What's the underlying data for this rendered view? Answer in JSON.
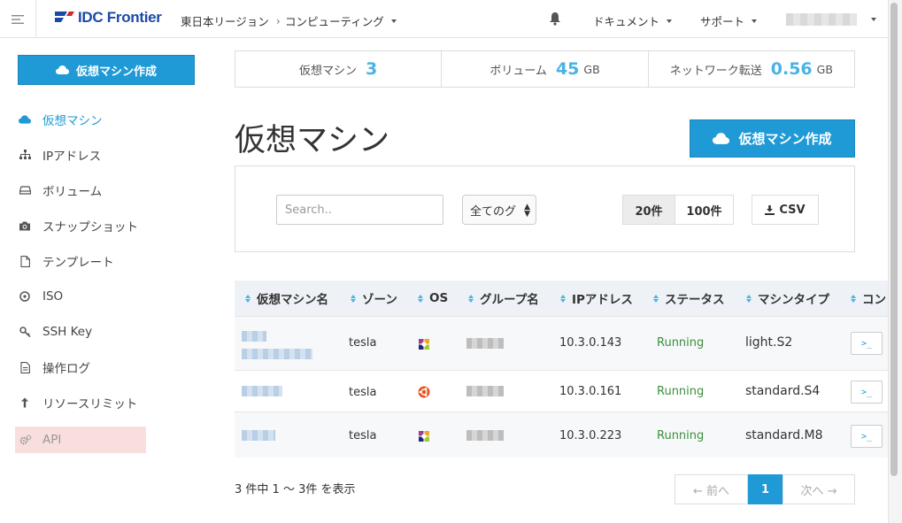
{
  "header": {
    "logo_text": "IDC Frontier",
    "region": "東日本リージョン",
    "separator": "›",
    "section": "コンピューティング",
    "docs": "ドキュメント",
    "support": "サポート"
  },
  "sidebar": {
    "create_button": "仮想マシン作成",
    "items": [
      {
        "label": "仮想マシン",
        "icon": "cloud-icon"
      },
      {
        "label": "IPアドレス",
        "icon": "network-icon"
      },
      {
        "label": "ボリューム",
        "icon": "drive-icon"
      },
      {
        "label": "スナップショット",
        "icon": "camera-icon"
      },
      {
        "label": "テンプレート",
        "icon": "file-icon"
      },
      {
        "label": "ISO",
        "icon": "disc-icon"
      },
      {
        "label": "SSH Key",
        "icon": "key-icon"
      },
      {
        "label": "操作ログ",
        "icon": "log-icon"
      },
      {
        "label": "リソースリミット",
        "icon": "upload-icon"
      },
      {
        "label": "API",
        "icon": "gears-icon"
      }
    ]
  },
  "stats": {
    "vm_label": "仮想マシン",
    "vm_count": "3",
    "volume_label": "ボリューム",
    "volume_value": "45",
    "volume_unit": "GB",
    "network_label": "ネットワーク転送",
    "network_value": "0.56",
    "network_unit": "GB"
  },
  "main": {
    "title": "仮想マシン",
    "create_button": "仮想マシン作成"
  },
  "filter": {
    "search_placeholder": "Search..",
    "group_select": "全てのグ",
    "page_size_20": "20件",
    "page_size_100": "100件",
    "csv": "CSV"
  },
  "table": {
    "headers": [
      "仮想マシン名",
      "ゾーン",
      "OS",
      "グループ名",
      "IPアドレス",
      "ステータス",
      "マシンタイプ",
      "コン"
    ],
    "rows": [
      {
        "zone": "tesla",
        "os": "centos",
        "ip": "10.3.0.143",
        "status": "Running",
        "type": "light.S2"
      },
      {
        "zone": "tesla",
        "os": "ubuntu",
        "ip": "10.3.0.161",
        "status": "Running",
        "type": "standard.S4"
      },
      {
        "zone": "tesla",
        "os": "centos",
        "ip": "10.3.0.223",
        "status": "Running",
        "type": "standard.M8"
      }
    ],
    "console_glyph": ">_"
  },
  "footer": {
    "summary": "3 件中 1 〜 3件 を表示",
    "prev": "← 前へ",
    "page": "1",
    "next": "次へ →"
  },
  "colors": {
    "accent": "#1f9ad6",
    "stat_number": "#4bb2e4",
    "running": "#3c8f3c",
    "api_highlight": "#f9dede"
  }
}
